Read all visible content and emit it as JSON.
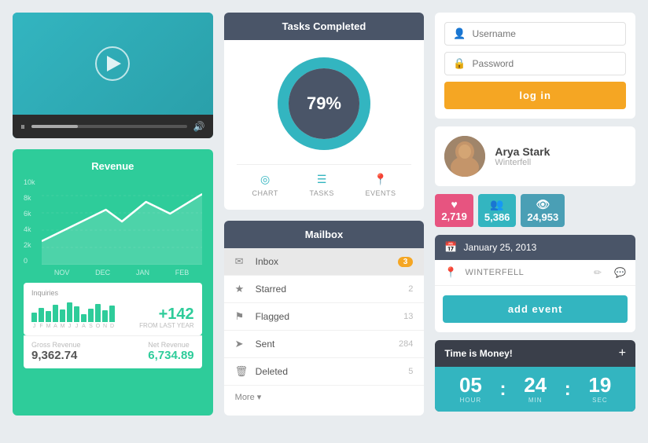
{
  "page": {
    "bg_color": "#e8ecef"
  },
  "video": {
    "pause_label": "⏸",
    "volume_label": "🔊"
  },
  "revenue": {
    "title": "Revenue",
    "y_labels": [
      "10k",
      "8k",
      "6k",
      "4k",
      "2k",
      "0"
    ],
    "x_labels": [
      "NOV",
      "DEC",
      "JAN",
      "FEB"
    ],
    "mini_x_labels": [
      "J",
      "F",
      "M",
      "A",
      "M",
      "J",
      "J",
      "A",
      "S",
      "O",
      "N",
      "D"
    ],
    "inquiries_label": "Inquiries",
    "from_last_year": "FROM LAST YEAR",
    "plus_num": "+142",
    "gross_label": "Gross Revenue",
    "gross_value": "9,362.74",
    "net_label": "Net Revenue",
    "net_value": "6,734.89"
  },
  "tasks": {
    "header": "Tasks Completed",
    "percent": "79%",
    "tabs": [
      {
        "icon": "◎",
        "label": "CHART"
      },
      {
        "icon": "☰",
        "label": "TASKS"
      },
      {
        "icon": "◉",
        "label": "EVENTS"
      }
    ]
  },
  "mailbox": {
    "header": "Mailbox",
    "items": [
      {
        "icon": "✉",
        "label": "Inbox",
        "badge": "3",
        "badge_type": "orange"
      },
      {
        "icon": "★",
        "label": "Starred",
        "count": "2"
      },
      {
        "icon": "⚑",
        "label": "Flagged",
        "count": "13"
      },
      {
        "icon": "➤",
        "label": "Sent",
        "count": "284"
      },
      {
        "icon": "🗑",
        "label": "Deleted",
        "count": "5"
      }
    ],
    "more_label": "More ▾"
  },
  "login": {
    "username_placeholder": "Username",
    "password_placeholder": "Password",
    "button_label": "log in"
  },
  "profile": {
    "name": "Arya Stark",
    "subtitle": "Winterfell",
    "stats": [
      {
        "icon": "♥",
        "value": "2,719",
        "color": "pink"
      },
      {
        "icon": "👥",
        "value": "5,386",
        "color": "teal"
      },
      {
        "icon": "👁",
        "value": "24,953",
        "color": "blue"
      }
    ]
  },
  "calendar": {
    "date": "January 25, 2013",
    "location": "WINTERFELL",
    "add_event_label": "add event"
  },
  "countdown": {
    "title": "Time is Money!",
    "plus_label": "+",
    "hours": "05",
    "minutes": "24",
    "seconds": "19",
    "hour_label": "HOUR",
    "min_label": "MIN",
    "sec_label": "SEC"
  }
}
